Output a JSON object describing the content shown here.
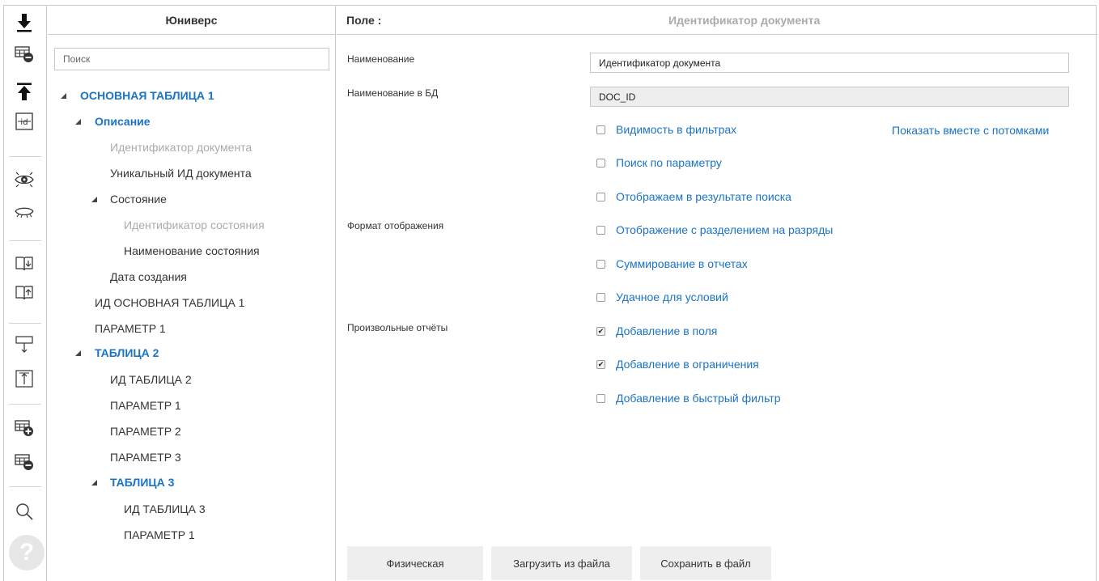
{
  "universe": {
    "title": "Юниверс",
    "search_placeholder": "Поиск",
    "tree": [
      {
        "label": "ОСНОВНАЯ ТАБЛИЦА 1",
        "style": "blue",
        "expanded": true
      },
      {
        "label": "Описание",
        "style": "blue",
        "expanded": true
      },
      {
        "label": "Идентификатор документа",
        "style": "grey"
      },
      {
        "label": "Уникальный ИД документа",
        "style": "plain"
      },
      {
        "label": "Состояние",
        "style": "plain",
        "expanded": true
      },
      {
        "label": "Идентификатор состояния",
        "style": "grey"
      },
      {
        "label": "Наименование состояния",
        "style": "plain"
      },
      {
        "label": "Дата создания",
        "style": "plain"
      },
      {
        "label": "ИД ОСНОВНАЯ ТАБЛИЦА 1",
        "style": "plain"
      },
      {
        "label": "ПАРАМЕТР 1",
        "style": "plain"
      },
      {
        "label": "ТАБЛИЦА 2",
        "style": "blue",
        "expanded": true
      },
      {
        "label": "ИД ТАБЛИЦА 2",
        "style": "plain"
      },
      {
        "label": "ПАРАМЕТР 1",
        "style": "plain"
      },
      {
        "label": "ПАРАМЕТР 2",
        "style": "plain"
      },
      {
        "label": "ПАРАМЕТР 3",
        "style": "plain"
      },
      {
        "label": "ТАБЛИЦА 3",
        "style": "blue",
        "expanded": true
      },
      {
        "label": "ИД ТАБЛИЦА 3",
        "style": "plain"
      },
      {
        "label": "ПАРАМЕТР 1",
        "style": "plain"
      }
    ]
  },
  "field": {
    "header_label": "Поле :",
    "header_title": "Идентификатор документа",
    "labels": {
      "name": "Наименование",
      "db_name": "Наименование в БД",
      "display_format": "Формат отображения",
      "custom_reports": "Произвольные отчёты"
    },
    "name_value": "Идентификатор документа",
    "db_name_value": "DOC_ID",
    "show_with_children_link": "Показать вместе с потомками",
    "checkboxes": [
      {
        "label": "Видимость в фильтрах",
        "checked": false
      },
      {
        "label": "Поиск по параметру",
        "checked": false
      },
      {
        "label": "Отображаем в результате поиска",
        "checked": false
      },
      {
        "label": "Отображение с разделением на разряды",
        "checked": false
      },
      {
        "label": "Суммирование в отчетах",
        "checked": false
      },
      {
        "label": "Удачное для условий",
        "checked": false
      },
      {
        "label": "Добавление в поля",
        "checked": true
      },
      {
        "label": "Добавление в ограничения",
        "checked": true
      },
      {
        "label": "Добавление в быстрый фильтр",
        "checked": false
      }
    ],
    "buttons": {
      "physical": "Физическая",
      "load": "Загрузить из файла",
      "save": "Сохранить в файл"
    }
  },
  "toolbar": {
    "icons": [
      "download-icon",
      "table-remove-icon",
      "upload-icon",
      "id-icon",
      "eye-open-icon",
      "eye-closed-icon",
      "book-import-icon",
      "book-export-icon",
      "panel-down-icon",
      "panel-up-icon",
      "table-add-icon",
      "table-delete-icon",
      "search-icon",
      "help-icon"
    ],
    "help_glyph": "?"
  },
  "colors": {
    "accent": "#1a73c4",
    "border": "#c8c8c8",
    "muted": "#aaaaaa"
  }
}
